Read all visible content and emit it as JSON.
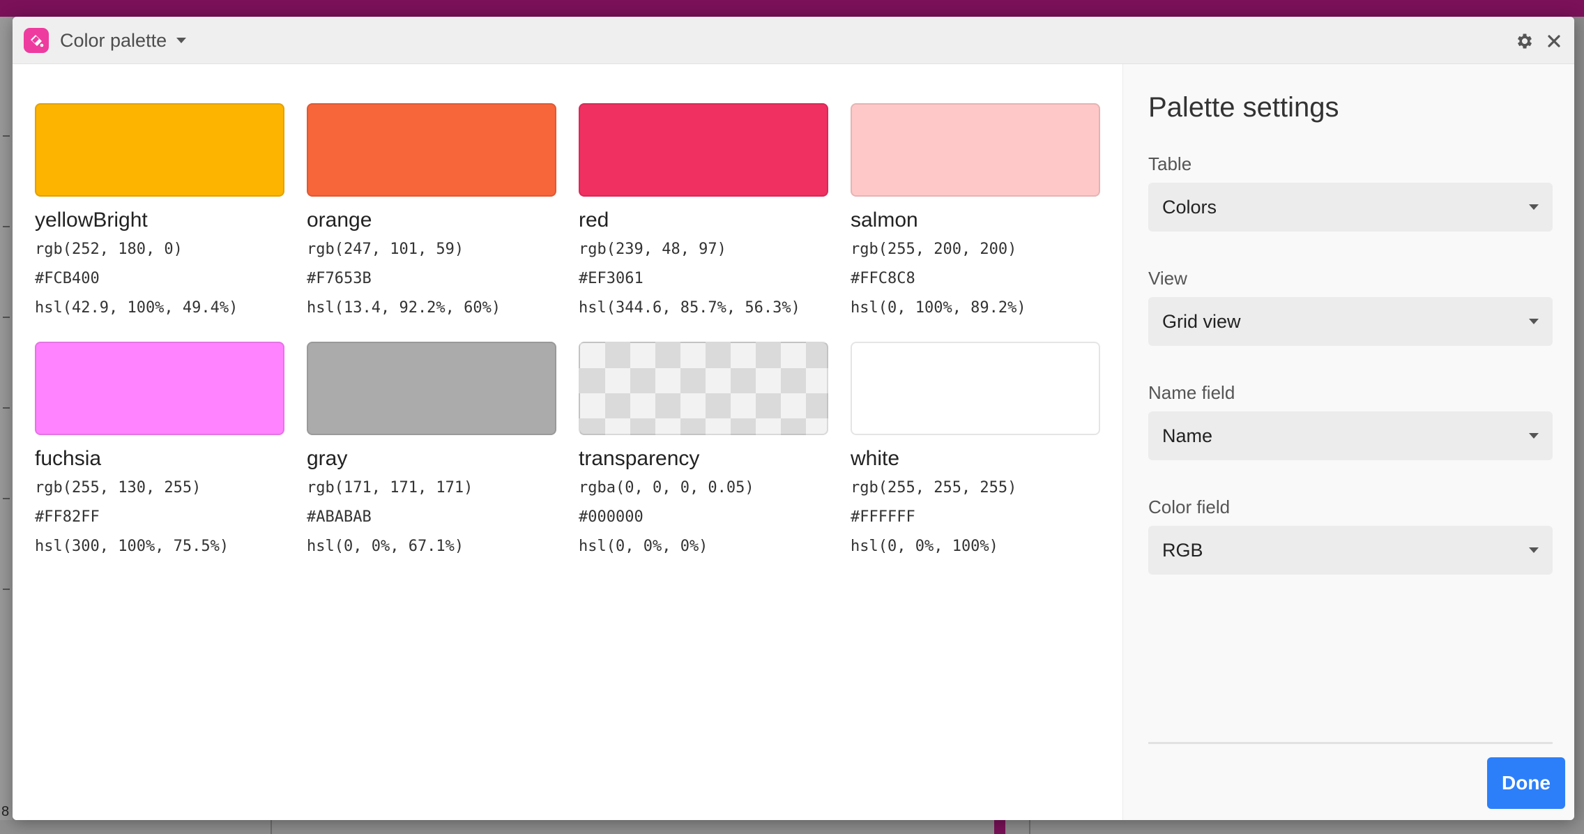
{
  "window": {
    "title": "Color palette"
  },
  "palette": [
    {
      "name": "yellowBright",
      "rgb": "rgb(252, 180, 0)",
      "hex": "#FCB400",
      "hsl": "hsl(42.9, 100%, 49.4%)",
      "color": "#FCB400"
    },
    {
      "name": "orange",
      "rgb": "rgb(247, 101, 59)",
      "hex": "#F7653B",
      "hsl": "hsl(13.4, 92.2%, 60%)",
      "color": "#F7653B"
    },
    {
      "name": "red",
      "rgb": "rgb(239, 48, 97)",
      "hex": "#EF3061",
      "hsl": "hsl(344.6, 85.7%, 56.3%)",
      "color": "#EF3061"
    },
    {
      "name": "salmon",
      "rgb": "rgb(255, 200, 200)",
      "hex": "#FFC8C8",
      "hsl": "hsl(0, 100%, 89.2%)",
      "color": "#FFC8C8"
    },
    {
      "name": "fuchsia",
      "rgb": "rgb(255, 130, 255)",
      "hex": "#FF82FF",
      "hsl": "hsl(300, 100%, 75.5%)",
      "color": "#FF82FF"
    },
    {
      "name": "gray",
      "rgb": "rgb(171, 171, 171)",
      "hex": "#ABABAB",
      "hsl": "hsl(0, 0%, 67.1%)",
      "color": "#ABABAB"
    },
    {
      "name": "transparency",
      "rgb": "rgba(0, 0, 0, 0.05)",
      "hex": "#000000",
      "hsl": "hsl(0, 0%, 0%)",
      "color": "transparent"
    },
    {
      "name": "white",
      "rgb": "rgb(255, 255, 255)",
      "hex": "#FFFFFF",
      "hsl": "hsl(0, 0%, 100%)",
      "color": "#FFFFFF"
    }
  ],
  "settings": {
    "title": "Palette settings",
    "fields": [
      {
        "label": "Table",
        "value": "Colors"
      },
      {
        "label": "View",
        "value": "Grid view"
      },
      {
        "label": "Name field",
        "value": "Name"
      },
      {
        "label": "Color field",
        "value": "RGB"
      }
    ],
    "done_label": "Done"
  },
  "background": {
    "row_number": "8"
  },
  "colors": {
    "accent": "#2d7ff9",
    "app_icon": "#ee3b9f",
    "top_bar": "#7b1159"
  }
}
